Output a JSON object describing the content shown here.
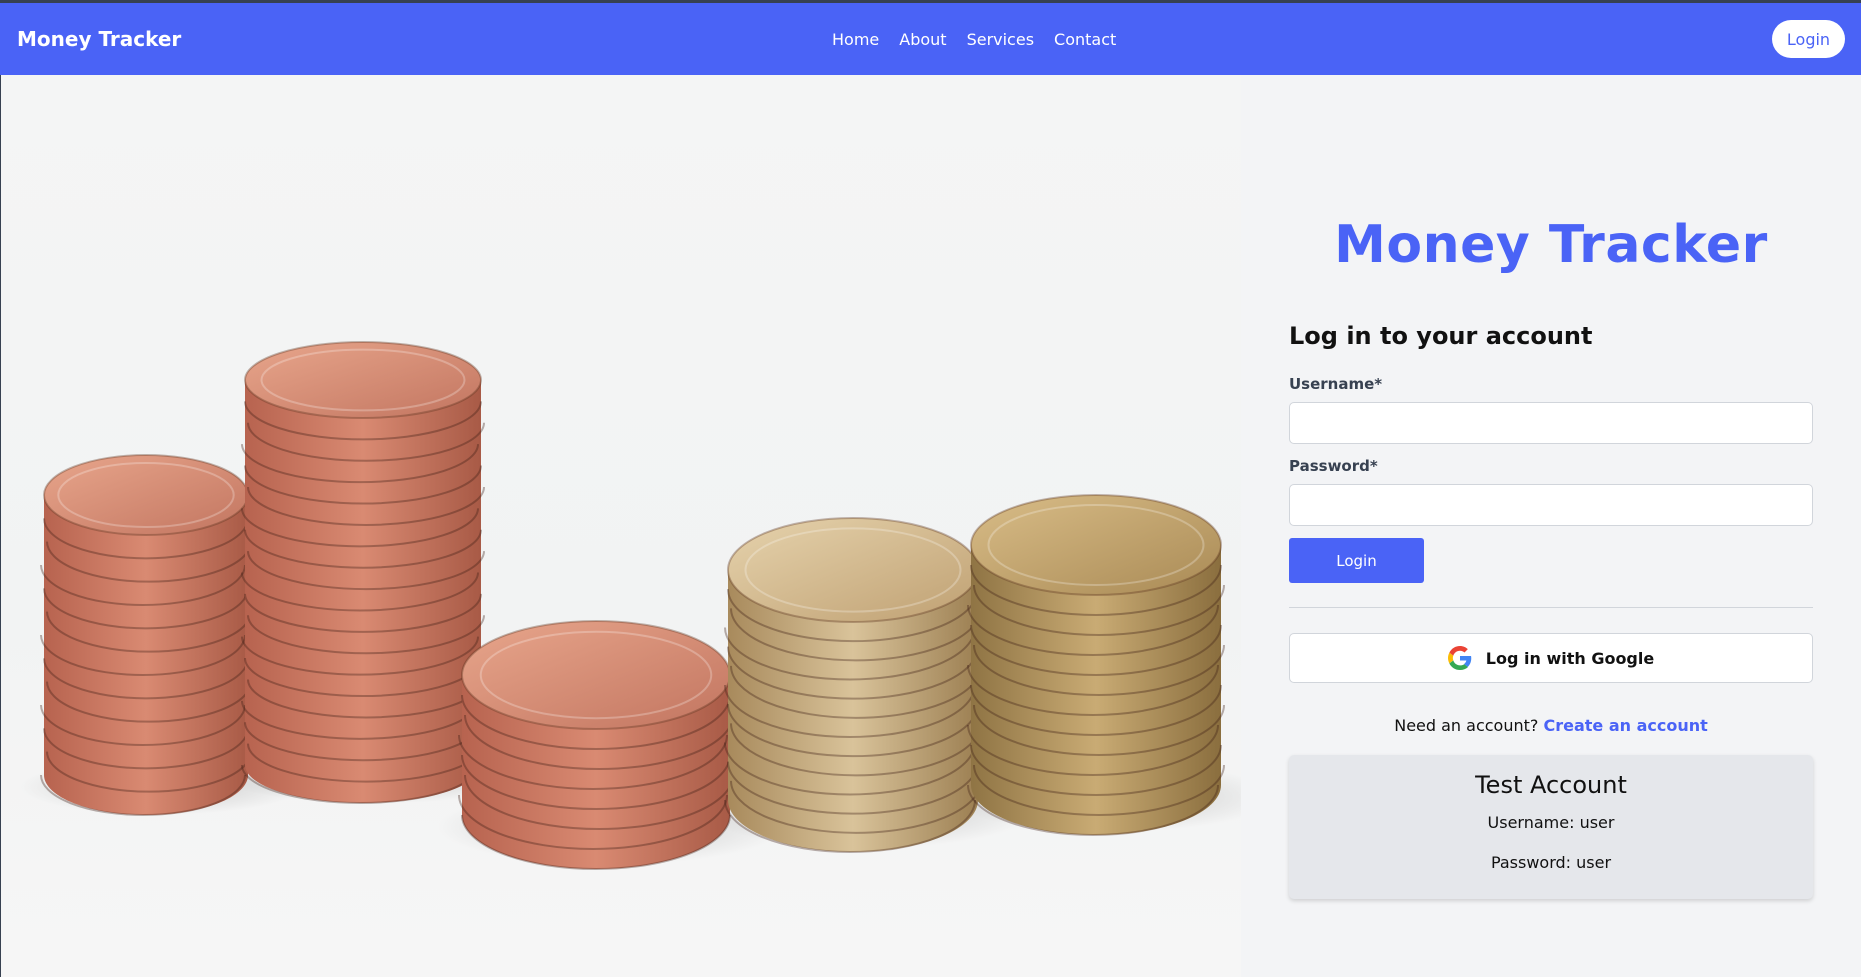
{
  "navbar": {
    "brand": "Money Tracker",
    "links": [
      "Home",
      "About",
      "Services",
      "Contact"
    ],
    "login_label": "Login"
  },
  "hero": {
    "image": "coin-stacks-photo"
  },
  "login_panel": {
    "title": "Money Tracker",
    "heading": "Log in to your account",
    "username_label": "Username*",
    "username_value": "",
    "password_label": "Password*",
    "password_value": "",
    "login_button": "Login",
    "google_button": "Log in with Google",
    "signup_prompt": "Need an account?",
    "signup_link": "Create an account"
  },
  "test_account": {
    "title": "Test Account",
    "username_line": "Username: user",
    "password_line": "Password: user"
  },
  "colors": {
    "accent": "#4a63f6",
    "background": "#f3f4f6",
    "card": "#e5e7eb"
  }
}
